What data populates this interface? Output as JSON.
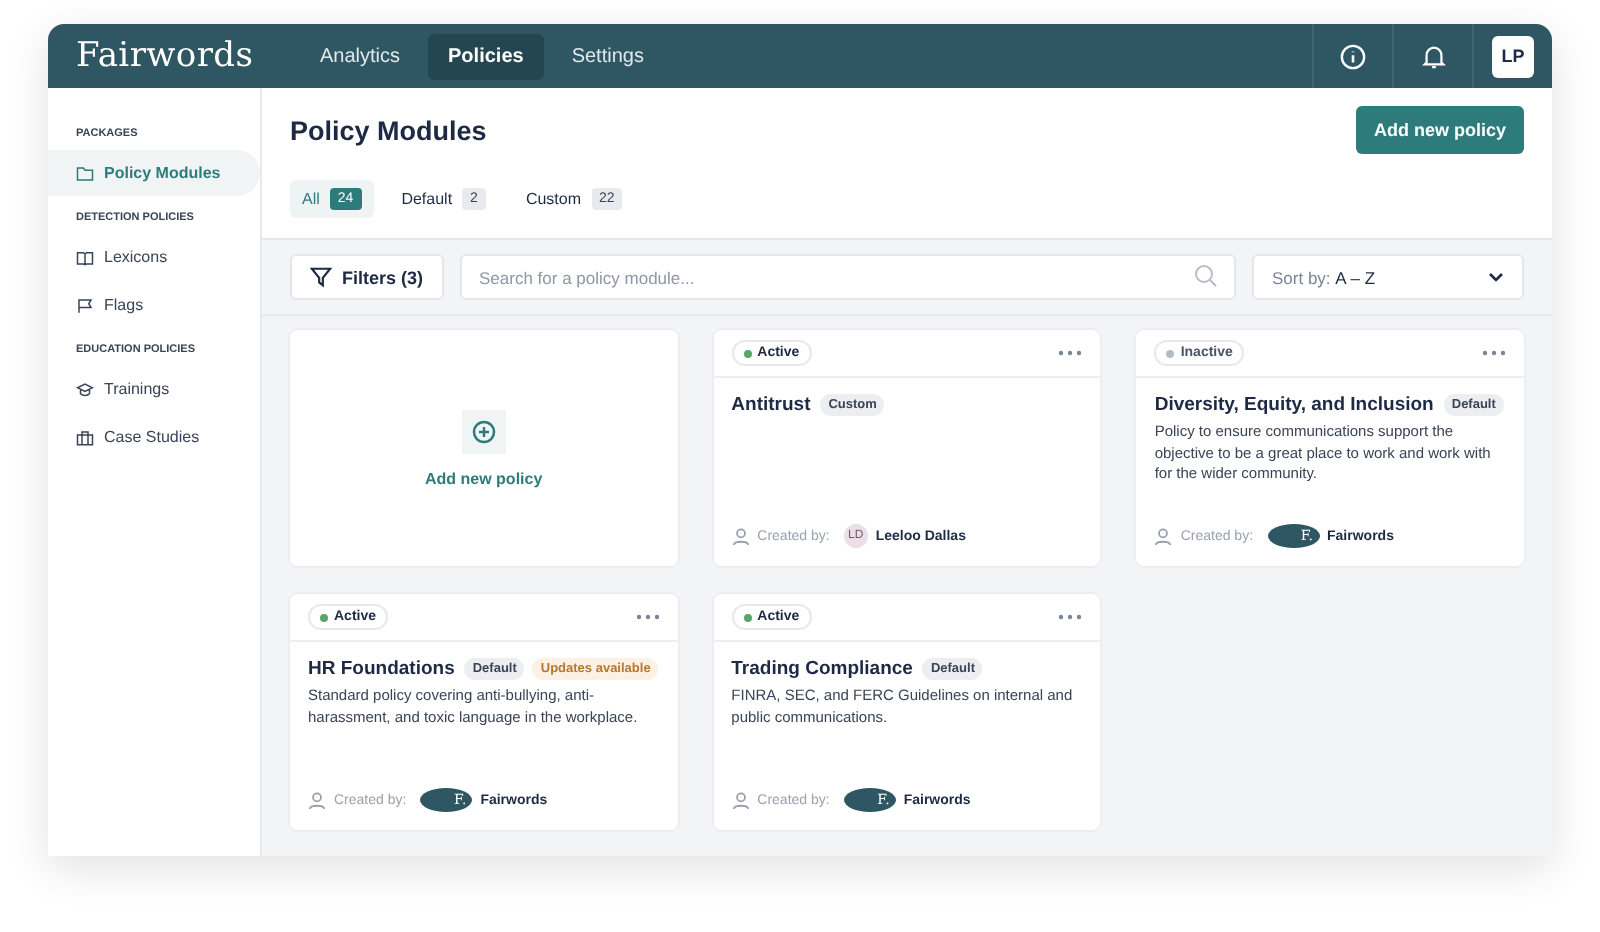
{
  "logo": "Fairwords",
  "nav": [
    {
      "label": "Analytics",
      "selected": false
    },
    {
      "label": "Policies",
      "selected": true
    },
    {
      "label": "Settings",
      "selected": false
    }
  ],
  "user_initials": "LP",
  "sidebar": [
    {
      "heading": "PACKAGES",
      "items": [
        {
          "label": "Policy Modules",
          "selected": true
        }
      ]
    },
    {
      "heading": "DETECTION POLICIES",
      "items": [
        {
          "label": "Lexicons",
          "selected": false
        },
        {
          "label": "Flags",
          "selected": false
        }
      ]
    },
    {
      "heading": "EDUCATION POLICIES",
      "items": [
        {
          "label": "Trainings",
          "selected": false
        },
        {
          "label": "Case Studies",
          "selected": false
        }
      ]
    }
  ],
  "page_title": "Policy Modules",
  "add_button": "Add new policy",
  "tabs": [
    {
      "label": "All",
      "count": "24",
      "selected": true
    },
    {
      "label": "Default",
      "count": "2",
      "selected": false
    },
    {
      "label": "Custom",
      "count": "22",
      "selected": false
    }
  ],
  "filters_button": "Filters (3)",
  "search": {
    "placeholder": "Search for a policy module..."
  },
  "sort": {
    "label": "Sort by:",
    "value": "A – Z"
  },
  "cards": [
    {
      "kind": "add",
      "label": "Add new policy"
    },
    {
      "kind": "policy",
      "status": "Active",
      "active": true,
      "title": "Antitrust",
      "tags": [
        {
          "label": "Custom",
          "kind": "plain"
        }
      ],
      "created_label": "Created by:",
      "author": "Leeloo Dallas",
      "author_avatar": {
        "kind": "person",
        "text": "LD"
      }
    },
    {
      "kind": "policy",
      "status": "Inactive",
      "active": false,
      "title": "Diversity, Equity, and Inclusion",
      "tags": [
        {
          "label": "Default",
          "kind": "plain"
        }
      ],
      "description": "Policy to ensure communications support the objective to be a great place to work and work with for the wider community.",
      "created_label": "Created by:",
      "author": "Fairwords",
      "author_avatar": {
        "kind": "logo",
        "text": "F."
      }
    },
    {
      "kind": "policy",
      "status": "Active",
      "active": true,
      "title": "HR Foundations",
      "tags": [
        {
          "label": "Default",
          "kind": "plain"
        },
        {
          "label": "Updates available",
          "kind": "update"
        }
      ],
      "description": "Standard policy covering anti-bullying, anti-harassment, and toxic language in the workplace.",
      "created_label": "Created by:",
      "author": "Fairwords",
      "author_avatar": {
        "kind": "logo",
        "text": "F."
      }
    },
    {
      "kind": "policy",
      "status": "Active",
      "active": true,
      "title": "Trading Compliance",
      "tags": [
        {
          "label": "Default",
          "kind": "plain"
        }
      ],
      "description": "FINRA, SEC, and FERC Guidelines on internal and public communications.",
      "created_label": "Created by:",
      "author": "Fairwords",
      "author_avatar": {
        "kind": "logo",
        "text": "F."
      }
    }
  ]
}
